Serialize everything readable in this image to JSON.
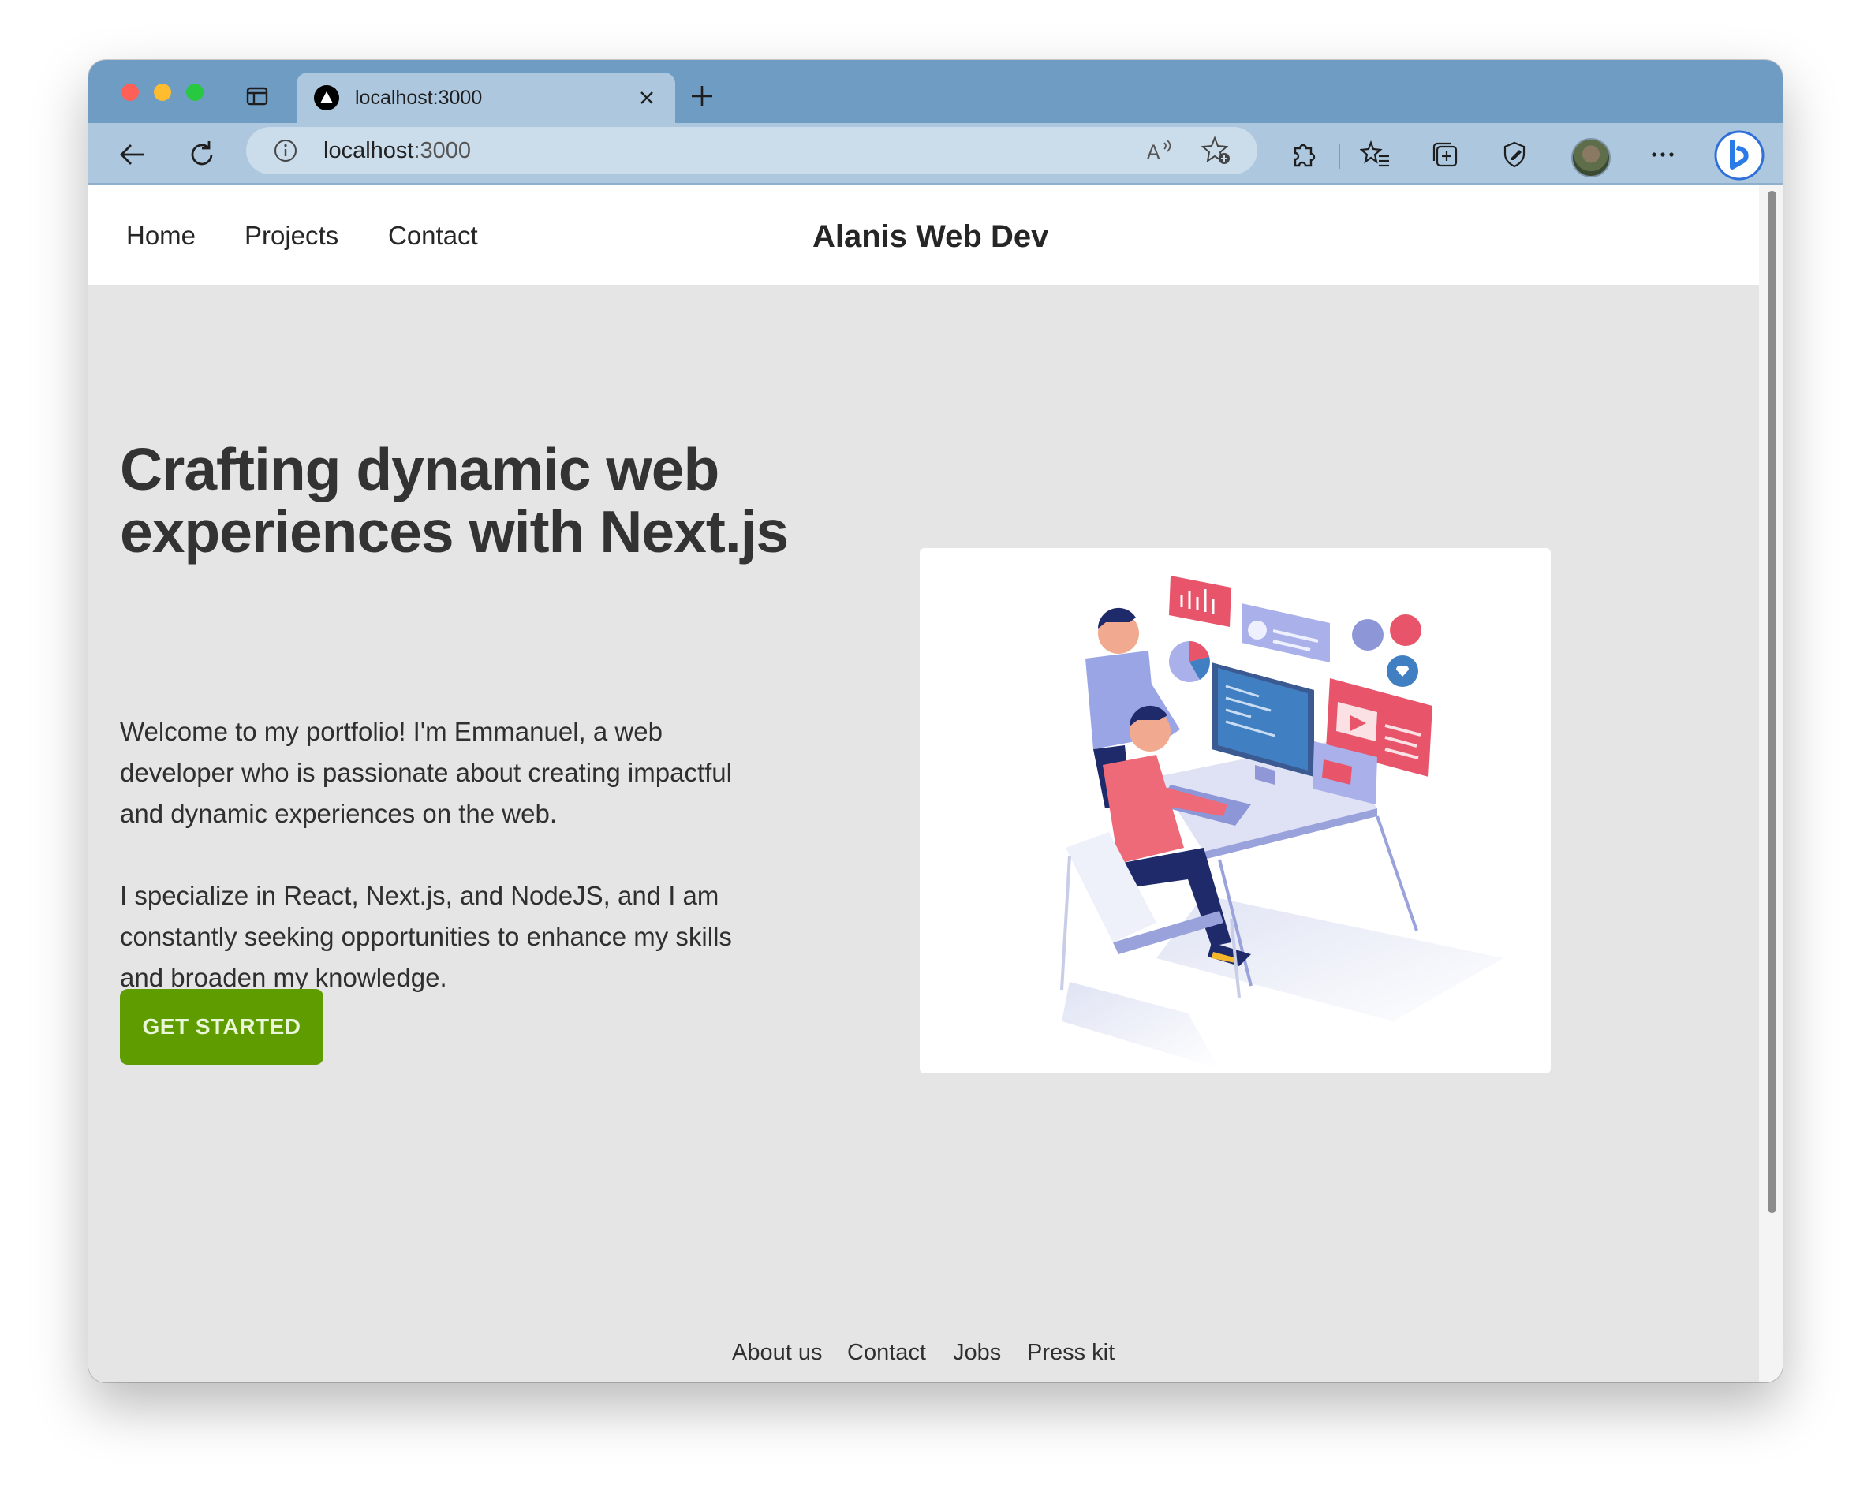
{
  "browser": {
    "tab_title": "localhost:3000",
    "url_host": "localhost",
    "url_port": ":3000",
    "accent_titlebar": "#6f9cc3",
    "accent_toolbar": "#adc8de"
  },
  "nav": {
    "links": [
      "Home",
      "Projects",
      "Contact"
    ],
    "brand": "Alanis Web Dev"
  },
  "hero": {
    "title": "Crafting dynamic web experiences with Next.js",
    "paragraph_1": "Welcome to my portfolio! I'm Emmanuel, a web developer who is passionate about creating impactful and dynamic experiences on the web.",
    "paragraph_2": "I specialize in React, Next.js, and NodeJS, and I am constantly seeking opportunities to enhance my skills and broaden my knowledge.",
    "cta_label": "GET STARTED",
    "cta_color": "#5e9c00"
  },
  "footer": {
    "links": [
      "About us",
      "Contact",
      "Jobs",
      "Press kit"
    ],
    "social_icons": [
      "twitter-icon",
      "youtube-icon"
    ]
  }
}
